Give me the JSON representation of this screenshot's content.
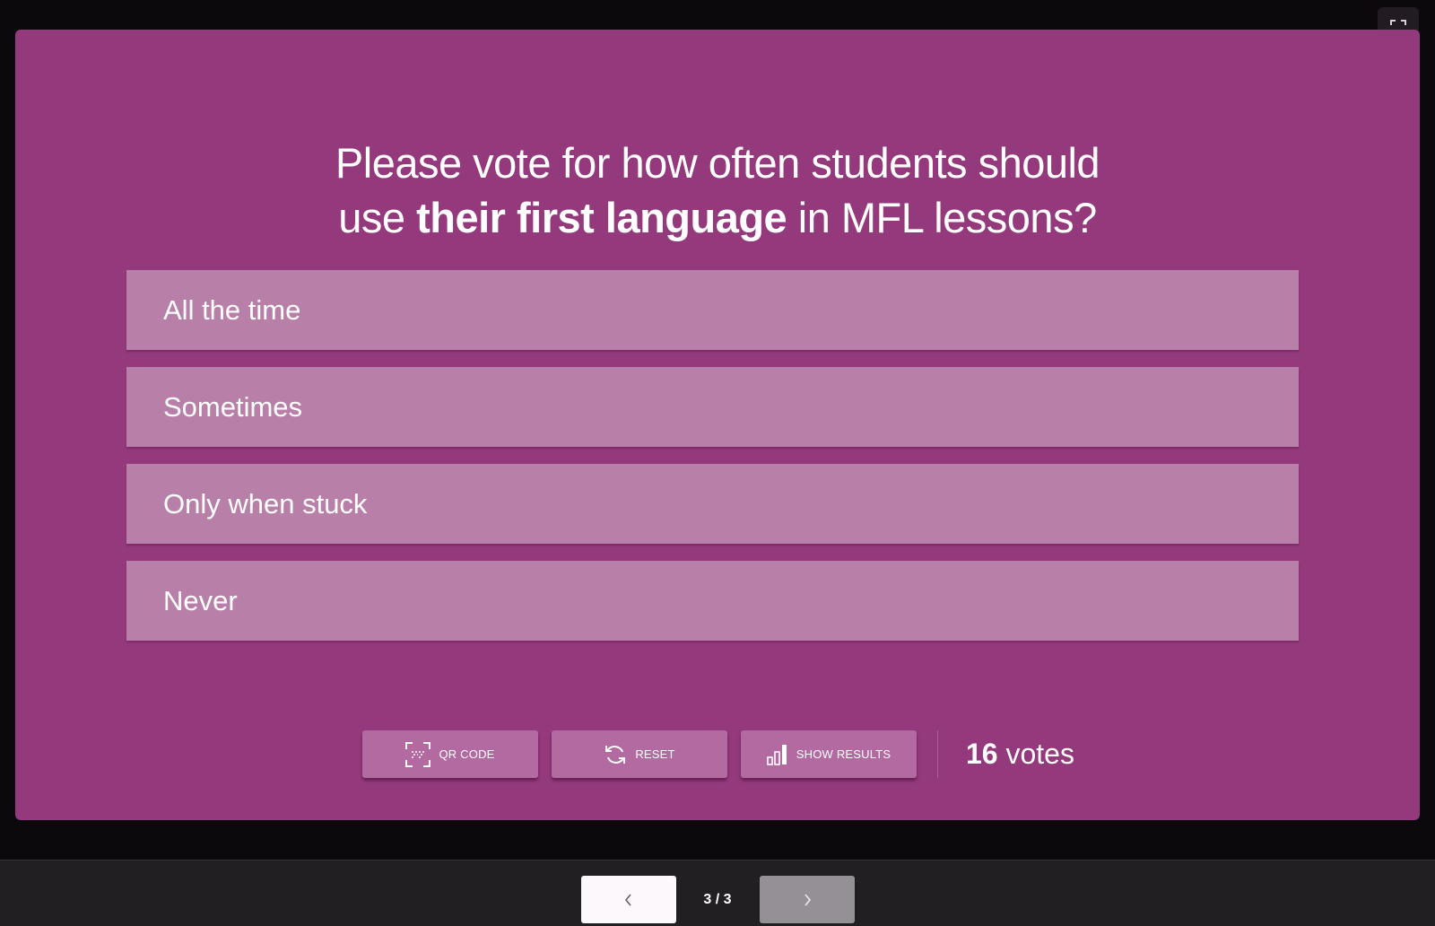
{
  "question": {
    "before": "Please vote for how often students should",
    "line2_pre": "use ",
    "emphasis": "their first language",
    "line2_post": " in MFL lessons?"
  },
  "options": [
    {
      "label": "All the time"
    },
    {
      "label": "Sometimes"
    },
    {
      "label": "Only when stuck"
    },
    {
      "label": "Never"
    }
  ],
  "controls": {
    "qr_label": "QR CODE",
    "reset_label": "RESET",
    "results_label": "SHOW RESULTS"
  },
  "votes": {
    "count": "16",
    "unit": " votes"
  },
  "pagination": {
    "indicator": "3 / 3"
  },
  "icons": {
    "fullscreen": "fullscreen-icon",
    "qr": "qr-code-icon",
    "reset": "refresh-icon",
    "results": "bar-chart-icon",
    "prev": "chevron-left-icon",
    "next": "chevron-right-icon"
  },
  "colors": {
    "slide_bg": "#93397c",
    "option_bg": "#b880a9",
    "button_bg": "#b36aa1",
    "bottom_bar": "#221f22"
  }
}
